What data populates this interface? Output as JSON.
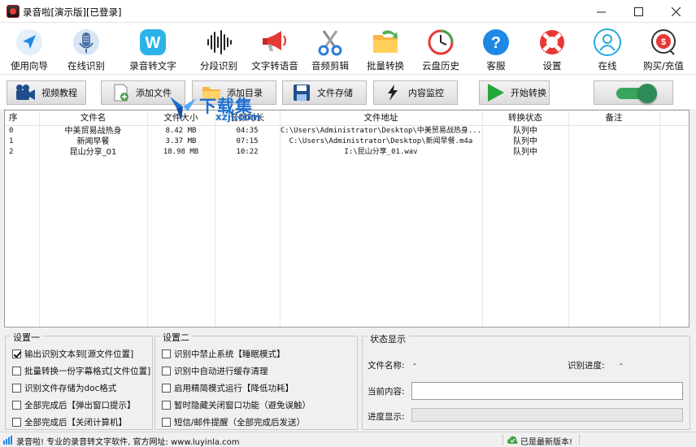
{
  "window": {
    "title": "录音啦[演示版][已登录]",
    "icon": "app-icon"
  },
  "toolbar": [
    {
      "label": "使用向导",
      "icon": "navigation-arrow-icon",
      "dropdown": false
    },
    {
      "label": "在线识别",
      "icon": "microphone-icon",
      "dropdown": true
    },
    {
      "label": "录音转文字",
      "icon": "word-icon",
      "dropdown": true
    },
    {
      "label": "分段识别",
      "icon": "waveform-icon",
      "dropdown": false
    },
    {
      "label": "文字转语音",
      "icon": "megaphone-icon",
      "dropdown": false
    },
    {
      "label": "音频剪辑",
      "icon": "scissors-icon",
      "dropdown": false
    },
    {
      "label": "批量转换",
      "icon": "folder-convert-icon",
      "dropdown": false
    },
    {
      "label": "云盘历史",
      "icon": "history-clock-icon",
      "dropdown": false
    },
    {
      "label": "客服",
      "icon": "help-icon",
      "dropdown": false
    },
    {
      "label": "设置",
      "icon": "lifebuoy-icon",
      "dropdown": false
    },
    {
      "label": "在线",
      "icon": "user-online-icon",
      "dropdown": false
    },
    {
      "label": "购买/充值",
      "icon": "purchase-icon",
      "dropdown": false
    }
  ],
  "actions": {
    "video_tutorial": "视频教程",
    "add_file": "添加文件",
    "add_directory": "添加目录",
    "file_storage": "文件存储",
    "content_monitor": "内容监控",
    "start_convert": "开始转换",
    "toggle_on": true
  },
  "watermark": {
    "text": "下载集",
    "url": "xzji.com"
  },
  "table": {
    "headers": [
      "序",
      "文件名",
      "文件大小",
      "音频时长",
      "文件地址",
      "转换状态",
      "备注"
    ],
    "rows": [
      [
        "0",
        "中美贸易战热身",
        "8.42 MB",
        "04:35",
        "C:\\Users\\Administrator\\Desktop\\中美贸易战热身...",
        "队列中",
        ""
      ],
      [
        "1",
        "新闻早餐",
        "3.37 MB",
        "07:15",
        "C:\\Users\\Administrator\\Desktop\\新闻早餐.m4a",
        "队列中",
        ""
      ],
      [
        "2",
        "昆山分享_01",
        "18.98 MB",
        "10:22",
        "I:\\昆山分享_01.wav",
        "队列中",
        ""
      ]
    ]
  },
  "settings1": {
    "title": "设置一",
    "options": [
      {
        "label": "输出识别文本到[源文件位置]",
        "checked": true
      },
      {
        "label": "批量转换一份字幕格式[文件位置]",
        "checked": false
      },
      {
        "label": "识别文件存储为doc格式",
        "checked": false
      },
      {
        "label": "全部完成后【弹出窗口提示】",
        "checked": false
      },
      {
        "label": "全部完成后【关闭计算机】",
        "checked": false
      }
    ]
  },
  "settings2": {
    "title": "设置二",
    "options": [
      {
        "label": "识别中禁止系统【睡眠模式】",
        "checked": false
      },
      {
        "label": "识别中自动进行缓存清理",
        "checked": false
      },
      {
        "label": "启用精简模式运行【降低功耗】",
        "checked": false
      },
      {
        "label": "暂时隐藏关闭窗口功能（避免误触）",
        "checked": false
      },
      {
        "label": "短信/邮件提醒（全部完成后发送）",
        "checked": false
      }
    ]
  },
  "status": {
    "title": "状态显示",
    "file_name_label": "文件名称:",
    "file_name_value": "-",
    "progress_label": "识别进度:",
    "progress_value": "-",
    "current_content_label": "当前内容:",
    "progress_display_label": "进度显示:",
    "progress_fraction": 0
  },
  "statusbar": {
    "left": "录音啦! 专业的录音转文字软件, 官方网址: www.luyinla.com",
    "right": "已是最新版本!"
  },
  "colors": {
    "accent_blue": "#1e88e5",
    "start_green": "#22a83a",
    "toggle_green": "#3aa55c",
    "watermark_blue": "#1e6fd1"
  }
}
